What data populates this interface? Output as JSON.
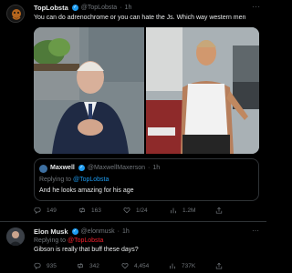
{
  "tweet": {
    "author_name": "TopLobsta",
    "handle": "@TopLobsta",
    "time": "1h",
    "text": "You can do adrenochrome or you can hate the Js. Which way western men"
  },
  "quote": {
    "author_name": "Maxwell",
    "handle": "@MaxwellMaxerson",
    "time": "1h",
    "replying_prefix": "Replying to",
    "replying_handle": "@TopLobsta",
    "text": "And he looks amazing for his age"
  },
  "quote_actions": {
    "replies": "149",
    "retweets": "163",
    "likes": "1/24",
    "views": "1.2M"
  },
  "reply": {
    "author_name": "Elon Musk",
    "handle": "@elonmusk",
    "time": "1h",
    "replying_prefix": "Replying to",
    "replying_handle": "@TopLobsta",
    "text": "Gibson is really that buff these days?"
  },
  "reply_actions": {
    "replies": "935",
    "retweets": "342",
    "likes": "4,454",
    "views": "737K"
  },
  "icons": {
    "reply": "speech-bubble-icon",
    "retweet": "retweet-icon",
    "like": "heart-icon",
    "views": "bar-chart-icon",
    "share": "share-icon",
    "more": "more-dots-icon",
    "verified": "verified-check-icon"
  },
  "colors": {
    "background": "#000000",
    "text": "#e7e9ea",
    "secondary": "#71767b",
    "accent": "#1d9bf0",
    "divider": "#2f3336"
  }
}
